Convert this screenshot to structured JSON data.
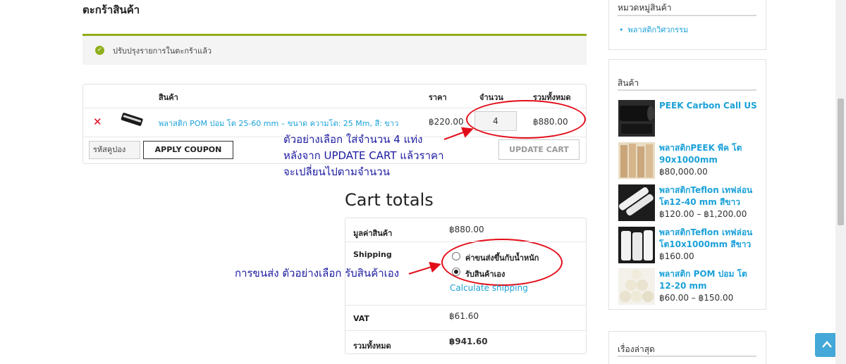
{
  "page_title": "ตะกร้าสินค้า",
  "notice": {
    "message": "ปรับปรุงรายการในตะกร้าแล้ว"
  },
  "cart": {
    "headers": {
      "product": "สินค้า",
      "price": "ราคา",
      "quantity": "จำนวน",
      "subtotal": "รวมทั้งหมด"
    },
    "item": {
      "name": "พลาสติก POM ปอม โต 25-60 mm – ขนาด ความโต: 25 Mm, สี: ขาว",
      "price": "฿220.00",
      "quantity": "4",
      "subtotal": "฿880.00"
    },
    "coupon_placeholder": "รหัสคูปอง",
    "apply_coupon": "APPLY COUPON",
    "update_cart": "UPDATE CART"
  },
  "annotations": {
    "qty_note_1": "ตัวอย่างเลือก ใส่จำนวน 4 แท่ง",
    "qty_note_2": "หลังจาก UPDATE CART แล้วราคา",
    "qty_note_3": "จะเปลี่ยนไปตามจำนวน",
    "shipping_note": "การขนส่ง ตัวอย่างเลือก รับสินค้าเอง",
    "accent_color": "#e30d19",
    "text_color": "#1c1ba0"
  },
  "totals": {
    "title": "Cart totals",
    "subtotal_label": "มูลค่าสินค้า",
    "subtotal_value": "฿880.00",
    "shipping_label": "Shipping",
    "shipping_options": [
      "ค่าขนส่งขึ้นกับน้ำหนัก",
      "รับสินค้าเอง"
    ],
    "shipping_selected": 1,
    "calculate_shipping": "Calculate shipping",
    "vat_label": "VAT",
    "vat_value": "฿61.60",
    "total_label": "รวมทั้งหมด",
    "total_value": "฿941.60"
  },
  "sidebar": {
    "categories_title": "หมวดหมู่สินค้า",
    "categories": [
      "พลาสติกวิศวกรรม"
    ],
    "products_title": "สินค้า",
    "products": [
      {
        "name": "PEEK Carbon Call US",
        "price": ""
      },
      {
        "name": "พลาสติกPEEK พีค โต 90x1000mm",
        "price": "฿80,000.00"
      },
      {
        "name": "พลาสติกTeflon เทฟล่อน โต12-40 mm สีขาว",
        "price": "฿120.00 – ฿1,200.00"
      },
      {
        "name": "พลาสติกTeflon เทฟล่อน โต10x1000mm สีขาว",
        "price": "฿160.00"
      },
      {
        "name": "พลาสติก POM ปอม โต 12-20 mm",
        "price": "฿60.00 – ฿150.00"
      }
    ],
    "recent_title": "เรื่องล่าสุด"
  },
  "colors": {
    "brand_green": "#8fae1b",
    "link_blue": "#1ba1d8",
    "remove_red": "#e2041b"
  }
}
